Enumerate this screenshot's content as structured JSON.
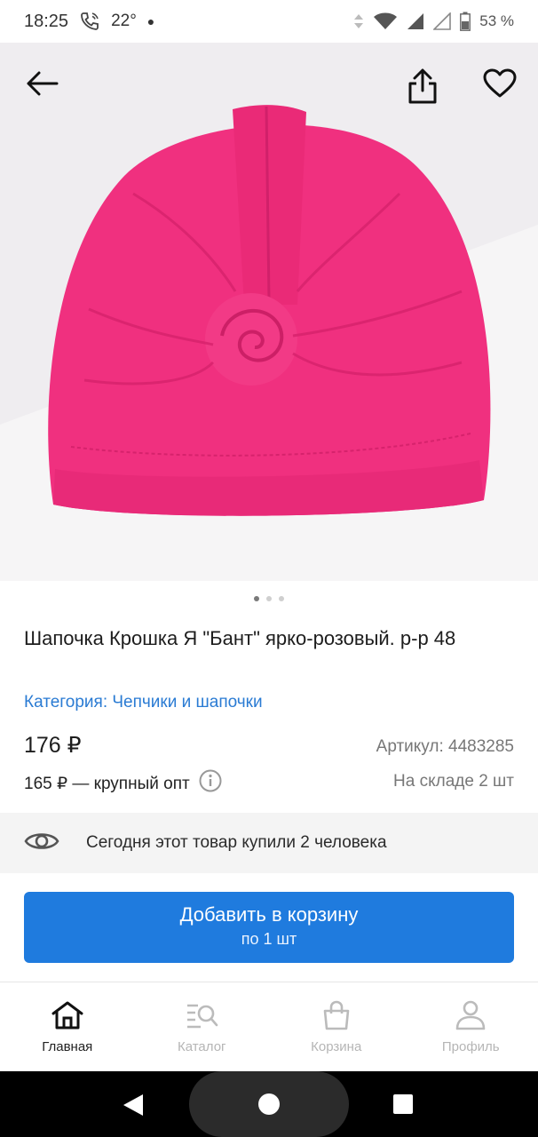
{
  "status_bar": {
    "time": "18:25",
    "temperature": "22°",
    "battery": "53 %"
  },
  "product": {
    "title": "Шапочка Крошка Я \"Бант\" ярко-розовый. р-р 48",
    "category_link": "Категория: Чепчики и шапочки",
    "price": "176 ₽",
    "article": "Артикул: 4483285",
    "wholesale_price": "165 ₽ — крупный опт",
    "stock": "На складе 2 шт",
    "image_count": 3,
    "active_image": 1
  },
  "social_proof": {
    "text": "Сегодня этот товар купили 2 человека"
  },
  "cart_button": {
    "label": "Добавить в корзину",
    "sublabel": "по 1 шт"
  },
  "bottom_nav": {
    "items": [
      {
        "label": "Главная",
        "icon": "home-icon",
        "active": true
      },
      {
        "label": "Каталог",
        "icon": "catalog-search-icon",
        "active": false
      },
      {
        "label": "Корзина",
        "icon": "shopping-bag-icon",
        "active": false
      },
      {
        "label": "Профиль",
        "icon": "profile-icon",
        "active": false
      }
    ]
  },
  "colors": {
    "accent": "#1f7bde",
    "link": "#2a7bd3",
    "product_pink": "#f0307f"
  }
}
